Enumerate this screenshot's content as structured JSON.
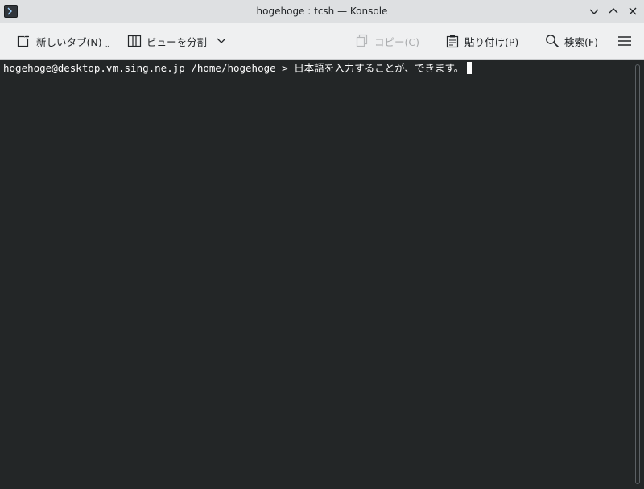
{
  "window": {
    "title": "hogehoge : tcsh — Konsole",
    "app_icon": "konsole-icon",
    "controls": [
      "minimize",
      "maximize",
      "close"
    ]
  },
  "toolbar": {
    "new_tab_label": "新しいタブ(N)",
    "split_view_label": "ビューを分割",
    "copy_label": "コピー(C)",
    "paste_label": "貼り付け(P)",
    "find_label": "検索(F)",
    "copy_enabled": false
  },
  "terminal": {
    "prompt": "hogehoge@desktop.vm.sing.ne.jp /home/hogehoge > ",
    "input": "日本語を入力することが、できます。"
  },
  "colors": {
    "titlebar_bg": "#dee0e2",
    "toolbar_bg": "#eff0f1",
    "terminal_bg": "#232627",
    "terminal_fg": "#fcfcfc"
  }
}
